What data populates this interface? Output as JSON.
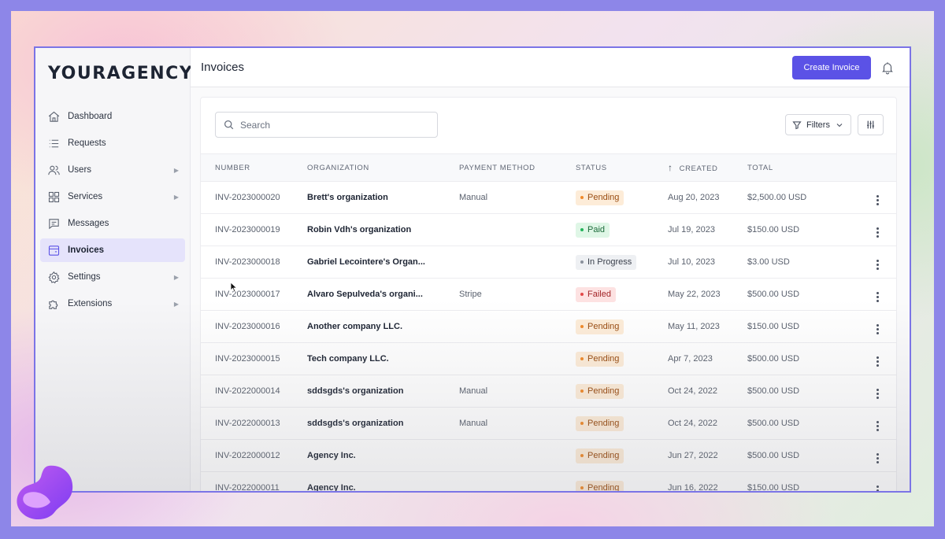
{
  "app": {
    "brand": "YOURAGENCY",
    "page_title": "Invoices",
    "create_button_label": "Create Invoice",
    "accent_color": "#5b52e6"
  },
  "sidebar": {
    "items": [
      {
        "label": "Dashboard",
        "icon": "home-icon",
        "has_submenu": false,
        "active": false
      },
      {
        "label": "Requests",
        "icon": "list-icon",
        "has_submenu": false,
        "active": false
      },
      {
        "label": "Users",
        "icon": "users-icon",
        "has_submenu": true,
        "active": false
      },
      {
        "label": "Services",
        "icon": "grid-icon",
        "has_submenu": true,
        "active": false
      },
      {
        "label": "Messages",
        "icon": "message-icon",
        "has_submenu": false,
        "active": false
      },
      {
        "label": "Invoices",
        "icon": "invoice-icon",
        "has_submenu": false,
        "active": true
      },
      {
        "label": "Settings",
        "icon": "gear-icon",
        "has_submenu": true,
        "active": false
      },
      {
        "label": "Extensions",
        "icon": "puzzle-icon",
        "has_submenu": true,
        "active": false
      }
    ]
  },
  "toolbar": {
    "search_placeholder": "Search",
    "search_value": "",
    "filters_label": "Filters"
  },
  "table": {
    "columns": [
      "NUMBER",
      "ORGANIZATION",
      "PAYMENT METHOD",
      "STATUS",
      "CREATED",
      "TOTAL"
    ],
    "sorted_column": "CREATED",
    "rows": [
      {
        "number": "INV-2023000020",
        "organization": "Brett's organization",
        "payment_method": "Manual",
        "status": "Pending",
        "created": "Aug 20, 2023",
        "total": "$2,500.00 USD"
      },
      {
        "number": "INV-2023000019",
        "organization": "Robin Vdh's organization",
        "payment_method": "",
        "status": "Paid",
        "created": "Jul 19, 2023",
        "total": "$150.00 USD"
      },
      {
        "number": "INV-2023000018",
        "organization": "Gabriel Lecointere's Organ...",
        "payment_method": "",
        "status": "In Progress",
        "created": "Jul 10, 2023",
        "total": "$3.00 USD"
      },
      {
        "number": "INV-2023000017",
        "organization": "Alvaro Sepulveda's organi...",
        "payment_method": "Stripe",
        "status": "Failed",
        "created": "May 22, 2023",
        "total": "$500.00 USD"
      },
      {
        "number": "INV-2023000016",
        "organization": "Another company LLC.",
        "payment_method": "",
        "status": "Pending",
        "created": "May 11, 2023",
        "total": "$150.00 USD"
      },
      {
        "number": "INV-2023000015",
        "organization": "Tech company LLC.",
        "payment_method": "",
        "status": "Pending",
        "created": "Apr 7, 2023",
        "total": "$500.00 USD"
      },
      {
        "number": "INV-2022000014",
        "organization": "sddsgds's organization",
        "payment_method": "Manual",
        "status": "Pending",
        "created": "Oct 24, 2022",
        "total": "$500.00 USD"
      },
      {
        "number": "INV-2022000013",
        "organization": "sddsgds's organization",
        "payment_method": "Manual",
        "status": "Pending",
        "created": "Oct 24, 2022",
        "total": "$500.00 USD"
      },
      {
        "number": "INV-2022000012",
        "organization": "Agency Inc.",
        "payment_method": "",
        "status": "Pending",
        "created": "Jun 27, 2022",
        "total": "$500.00 USD"
      },
      {
        "number": "INV-2022000011",
        "organization": "Agency Inc.",
        "payment_method": "",
        "status": "Pending",
        "created": "Jun 16, 2022",
        "total": "$150.00 USD"
      }
    ]
  },
  "status_colors": {
    "Pending": {
      "bg": "#fdecd8",
      "fg": "#9a4d12",
      "dot": "#f08a2a"
    },
    "Paid": {
      "bg": "#dff6e6",
      "fg": "#1c6b3a",
      "dot": "#22b45a"
    },
    "In Progress": {
      "bg": "#eef0f3",
      "fg": "#3a404c",
      "dot": "#8a909b"
    },
    "Failed": {
      "bg": "#fde2e2",
      "fg": "#a3262a",
      "dot": "#e34848"
    }
  }
}
